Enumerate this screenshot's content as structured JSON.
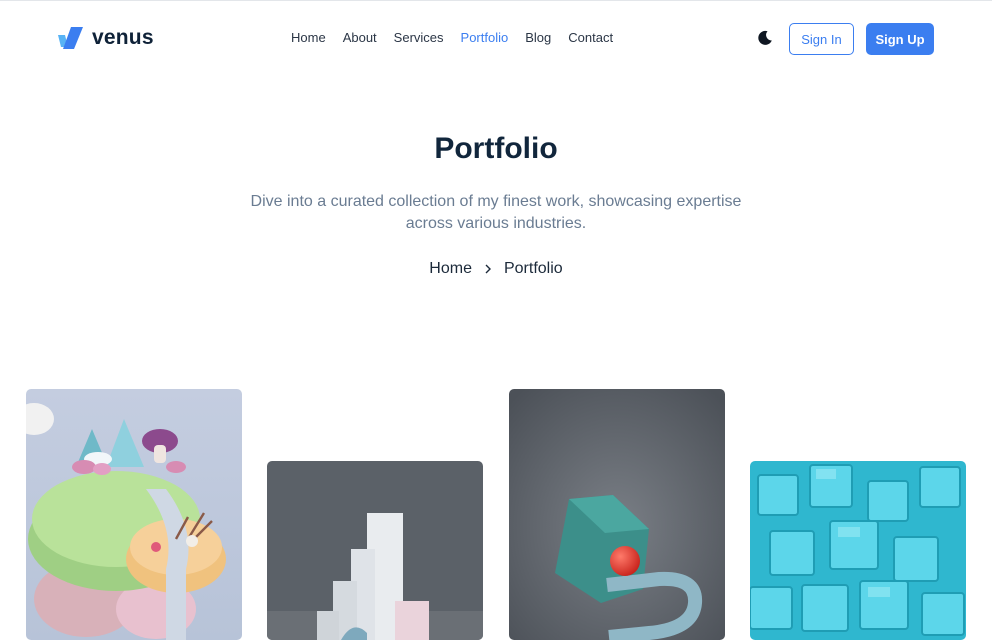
{
  "brand": {
    "name": "venus",
    "accent": "#3b7ef0"
  },
  "nav": {
    "items": [
      {
        "label": "Home"
      },
      {
        "label": "About"
      },
      {
        "label": "Services"
      },
      {
        "label": "Portfolio",
        "active": true
      },
      {
        "label": "Blog"
      },
      {
        "label": "Contact"
      }
    ]
  },
  "header": {
    "theme_toggle_icon": "moon-icon",
    "signin_label": "Sign In",
    "signup_label": "Sign Up"
  },
  "hero": {
    "title": "Portfolio",
    "subtitle": "Dive into a curated collection of my finest work, showcasing expertise across various industries."
  },
  "breadcrumb": {
    "home": "Home",
    "separator_icon": "chevron-right-icon",
    "current": "Portfolio"
  },
  "portfolio": {
    "items": [
      {
        "image": "floating-island-3d-illustration"
      },
      {
        "image": "white-blocks-3d-illustration"
      },
      {
        "image": "hexagon-and-ball-3d-illustration"
      },
      {
        "image": "cyan-cubes-3d-illustration"
      }
    ]
  }
}
